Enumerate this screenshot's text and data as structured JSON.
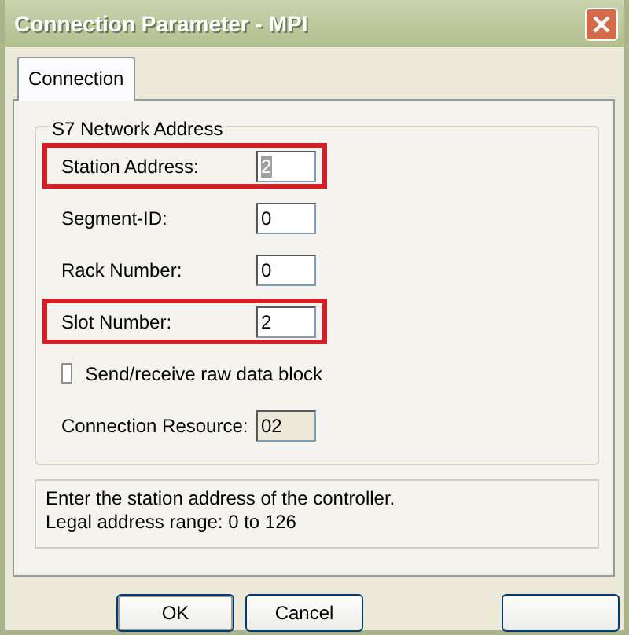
{
  "window": {
    "title": "Connection Parameter - MPI"
  },
  "tabs": [
    {
      "label": "Connection",
      "selected": true
    }
  ],
  "group": {
    "title": "S7 Network Address",
    "rows": [
      {
        "kind": "field",
        "label": "Station Address:",
        "value": "2",
        "highlighted": true,
        "focused": true,
        "disabled": false
      },
      {
        "kind": "field",
        "label": "Segment-ID:",
        "value": "0",
        "highlighted": false,
        "focused": false,
        "disabled": false
      },
      {
        "kind": "field",
        "label": "Rack Number:",
        "value": "0",
        "highlighted": false,
        "focused": false,
        "disabled": false
      },
      {
        "kind": "field",
        "label": "Slot Number:",
        "value": "2",
        "highlighted": true,
        "focused": false,
        "disabled": false
      },
      {
        "kind": "checkbox",
        "label": "Send/receive raw data block",
        "checked": false
      },
      {
        "kind": "field",
        "label": "Connection Resource:",
        "value": "02",
        "highlighted": false,
        "focused": false,
        "disabled": true
      }
    ]
  },
  "info": [
    "Enter the station address of the controller.",
    "Legal address range: 0 to 126"
  ],
  "buttons": [
    {
      "label": "OK",
      "default": true
    },
    {
      "label": "Cancel",
      "default": false
    },
    {
      "default": false
    }
  ]
}
